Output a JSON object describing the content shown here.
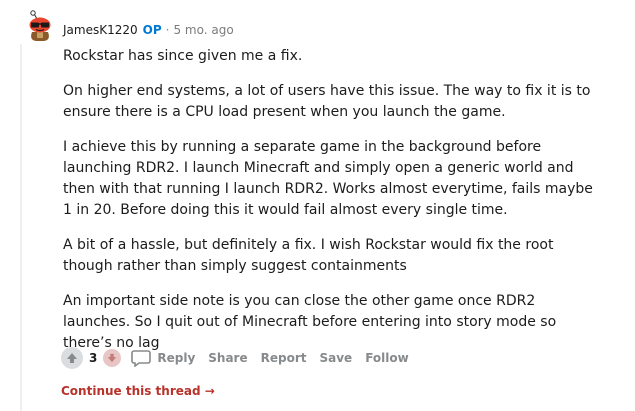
{
  "comment": {
    "author": "JamesK1220",
    "op_badge": "OP",
    "separator": "·",
    "time": "5 mo. ago",
    "paragraphs": [
      "Rockstar has since given me a fix.",
      "On higher end systems, a lot of users have this issue. The way to fix it is to ensure there is a CPU load present when you launch the game.",
      "I achieve this by running a separate game in the background before launching RDR2. I launch Minecraft and simply open a generic world and then with that running I launch RDR2. Works almost everytime, fails maybe 1 in 20. Before doing this it would fail almost every single time.",
      "A bit of a hassle, but definitely a fix. I wish Rockstar would fix the root though rather than simply suggest containments",
      "An important side note is you can close the other game once RDR2 launches. So I quit out of Minecraft before entering into story mode so there’s no lag"
    ]
  },
  "actions": {
    "score": "3",
    "reply": "Reply",
    "share": "Share",
    "report": "Report",
    "save": "Save",
    "follow": "Follow"
  },
  "continue_thread": "Continue this thread →",
  "icons": {
    "avatar": "snoo-avatar-icon",
    "upvote": "upvote-icon",
    "downvote": "downvote-icon",
    "reply": "comment-bubble-icon"
  },
  "colors": {
    "op": "#0079d3",
    "continue": "#b8322a",
    "muted": "#878a8c"
  }
}
